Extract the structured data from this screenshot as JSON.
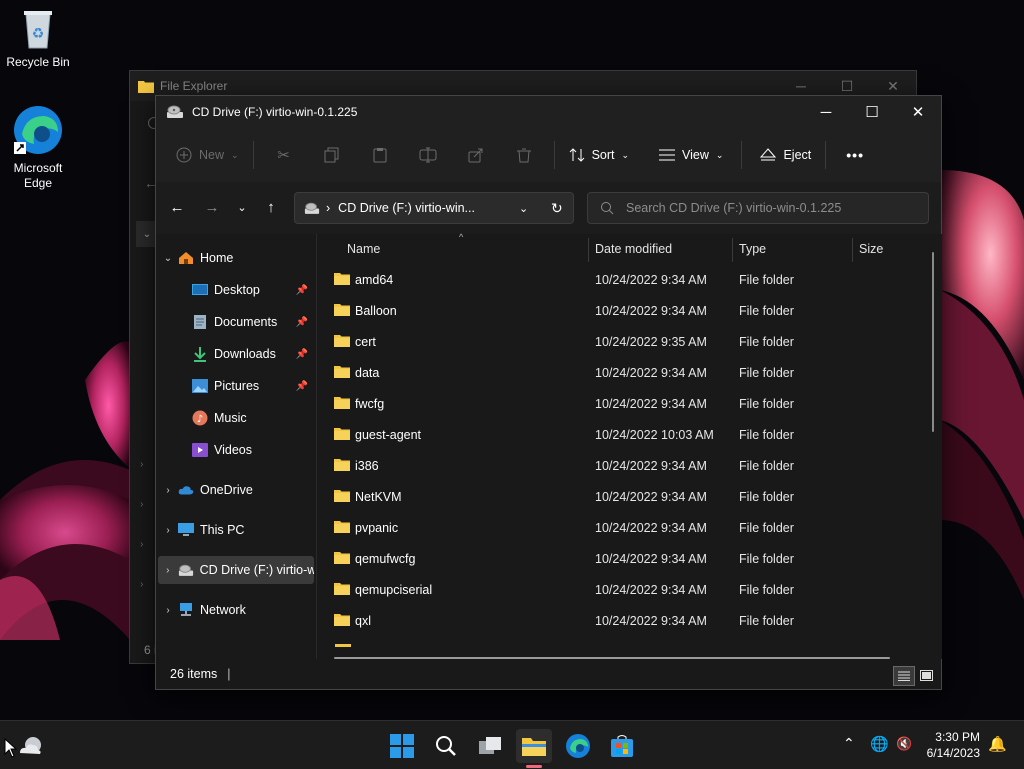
{
  "desktop": {
    "recycle_bin": "Recycle Bin",
    "edge": "Microsoft Edge"
  },
  "bg_window": {
    "title": "File Explorer",
    "status": "6 i"
  },
  "window": {
    "title": "CD Drive (F:) virtio-win-0.1.225",
    "caption": {
      "minimize": "─",
      "maximize": "☐",
      "close": "✕"
    }
  },
  "toolbar": {
    "new": "New",
    "sort": "Sort",
    "view": "View",
    "eject": "Eject",
    "more": "•••"
  },
  "address": {
    "sep": "›",
    "path": "CD Drive (F:) virtio-win...",
    "search_placeholder": "Search CD Drive (F:) virtio-win-0.1.225"
  },
  "nav": {
    "home": "Home",
    "desktop": "Desktop",
    "documents": "Documents",
    "downloads": "Downloads",
    "pictures": "Pictures",
    "music": "Music",
    "videos": "Videos",
    "onedrive": "OneDrive",
    "thispc": "This PC",
    "cddrive": "CD Drive (F:) virtio-w",
    "network": "Network"
  },
  "columns": {
    "name": "Name",
    "date": "Date modified",
    "type": "Type",
    "size": "Size"
  },
  "files": [
    {
      "name": "amd64",
      "date": "10/24/2022 9:34 AM",
      "type": "File folder"
    },
    {
      "name": "Balloon",
      "date": "10/24/2022 9:34 AM",
      "type": "File folder"
    },
    {
      "name": "cert",
      "date": "10/24/2022 9:35 AM",
      "type": "File folder"
    },
    {
      "name": "data",
      "date": "10/24/2022 9:34 AM",
      "type": "File folder"
    },
    {
      "name": "fwcfg",
      "date": "10/24/2022 9:34 AM",
      "type": "File folder"
    },
    {
      "name": "guest-agent",
      "date": "10/24/2022 10:03 AM",
      "type": "File folder"
    },
    {
      "name": "i386",
      "date": "10/24/2022 9:34 AM",
      "type": "File folder"
    },
    {
      "name": "NetKVM",
      "date": "10/24/2022 9:34 AM",
      "type": "File folder"
    },
    {
      "name": "pvpanic",
      "date": "10/24/2022 9:34 AM",
      "type": "File folder"
    },
    {
      "name": "qemufwcfg",
      "date": "10/24/2022 9:34 AM",
      "type": "File folder"
    },
    {
      "name": "qemupciserial",
      "date": "10/24/2022 9:34 AM",
      "type": "File folder"
    },
    {
      "name": "qxl",
      "date": "10/24/2022 9:34 AM",
      "type": "File folder"
    }
  ],
  "status": {
    "items": "26 items",
    "divider": "|"
  },
  "taskbar": {
    "time": "3:30 PM",
    "date": "6/14/2023"
  },
  "colors": {
    "accent": "#0078d4",
    "folder": "#f3c642",
    "selected": "#3a3a3a"
  }
}
